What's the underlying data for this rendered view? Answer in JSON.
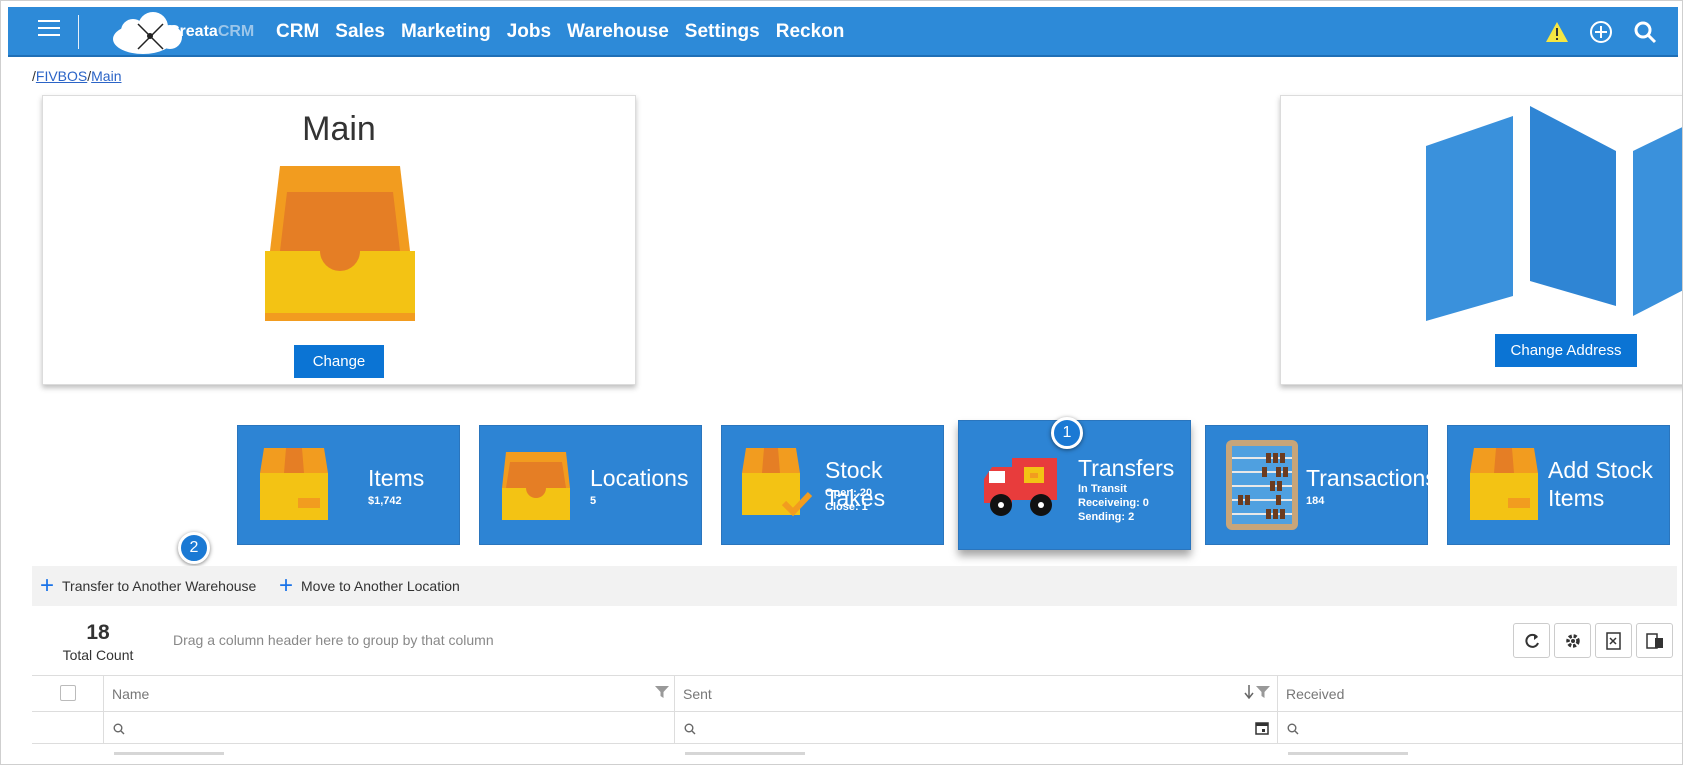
{
  "app": {
    "logo_brand": "Creata",
    "logo_suffix": "CRM"
  },
  "nav": {
    "items": [
      "CRM",
      "Sales",
      "Marketing",
      "Jobs",
      "Warehouse",
      "Settings",
      "Reckon"
    ]
  },
  "top_icons": [
    "warning-icon",
    "add-circle-icon",
    "search-icon"
  ],
  "breadcrumb": {
    "sep": "/",
    "part1": "FIVBOS",
    "part2": "Main"
  },
  "warehouse_card": {
    "title": "Main",
    "change_button": "Change"
  },
  "address_card": {
    "change_address_button": "Change Address"
  },
  "tiles": [
    {
      "name": "Items",
      "sub": [
        "$1,742"
      ]
    },
    {
      "name": "Locations",
      "sub": [
        "5"
      ]
    },
    {
      "name": "Stock Takes",
      "sub": [
        "Open: 20",
        "Close: 1"
      ]
    },
    {
      "name": "Transfers",
      "sub": [
        "In Transit",
        "Receiveing: 0",
        "Sending: 2"
      ]
    },
    {
      "name": "Transactions",
      "sub": [
        "184"
      ]
    },
    {
      "name": "Add Stock Items",
      "name_line1": "Add Stock",
      "name_line2": "Items",
      "sub": []
    }
  ],
  "markers": [
    "1",
    "2"
  ],
  "actions": {
    "transfer_warehouse": "Transfer to Another Warehouse",
    "move_location": "Move to Another Location"
  },
  "summary": {
    "total_count": "18",
    "total_label": "Total Count",
    "group_hint": "Drag a column header here to group by that column"
  },
  "toolbar": [
    "refresh-icon",
    "settings-icon",
    "export-excel-icon",
    "column-chooser-icon"
  ],
  "grid": {
    "columns": [
      "Name",
      "Sent",
      "Received"
    ]
  },
  "colors": {
    "topbar": "#2d8ad8",
    "tile": "#2d84d4",
    "button": "#0b74d4"
  }
}
